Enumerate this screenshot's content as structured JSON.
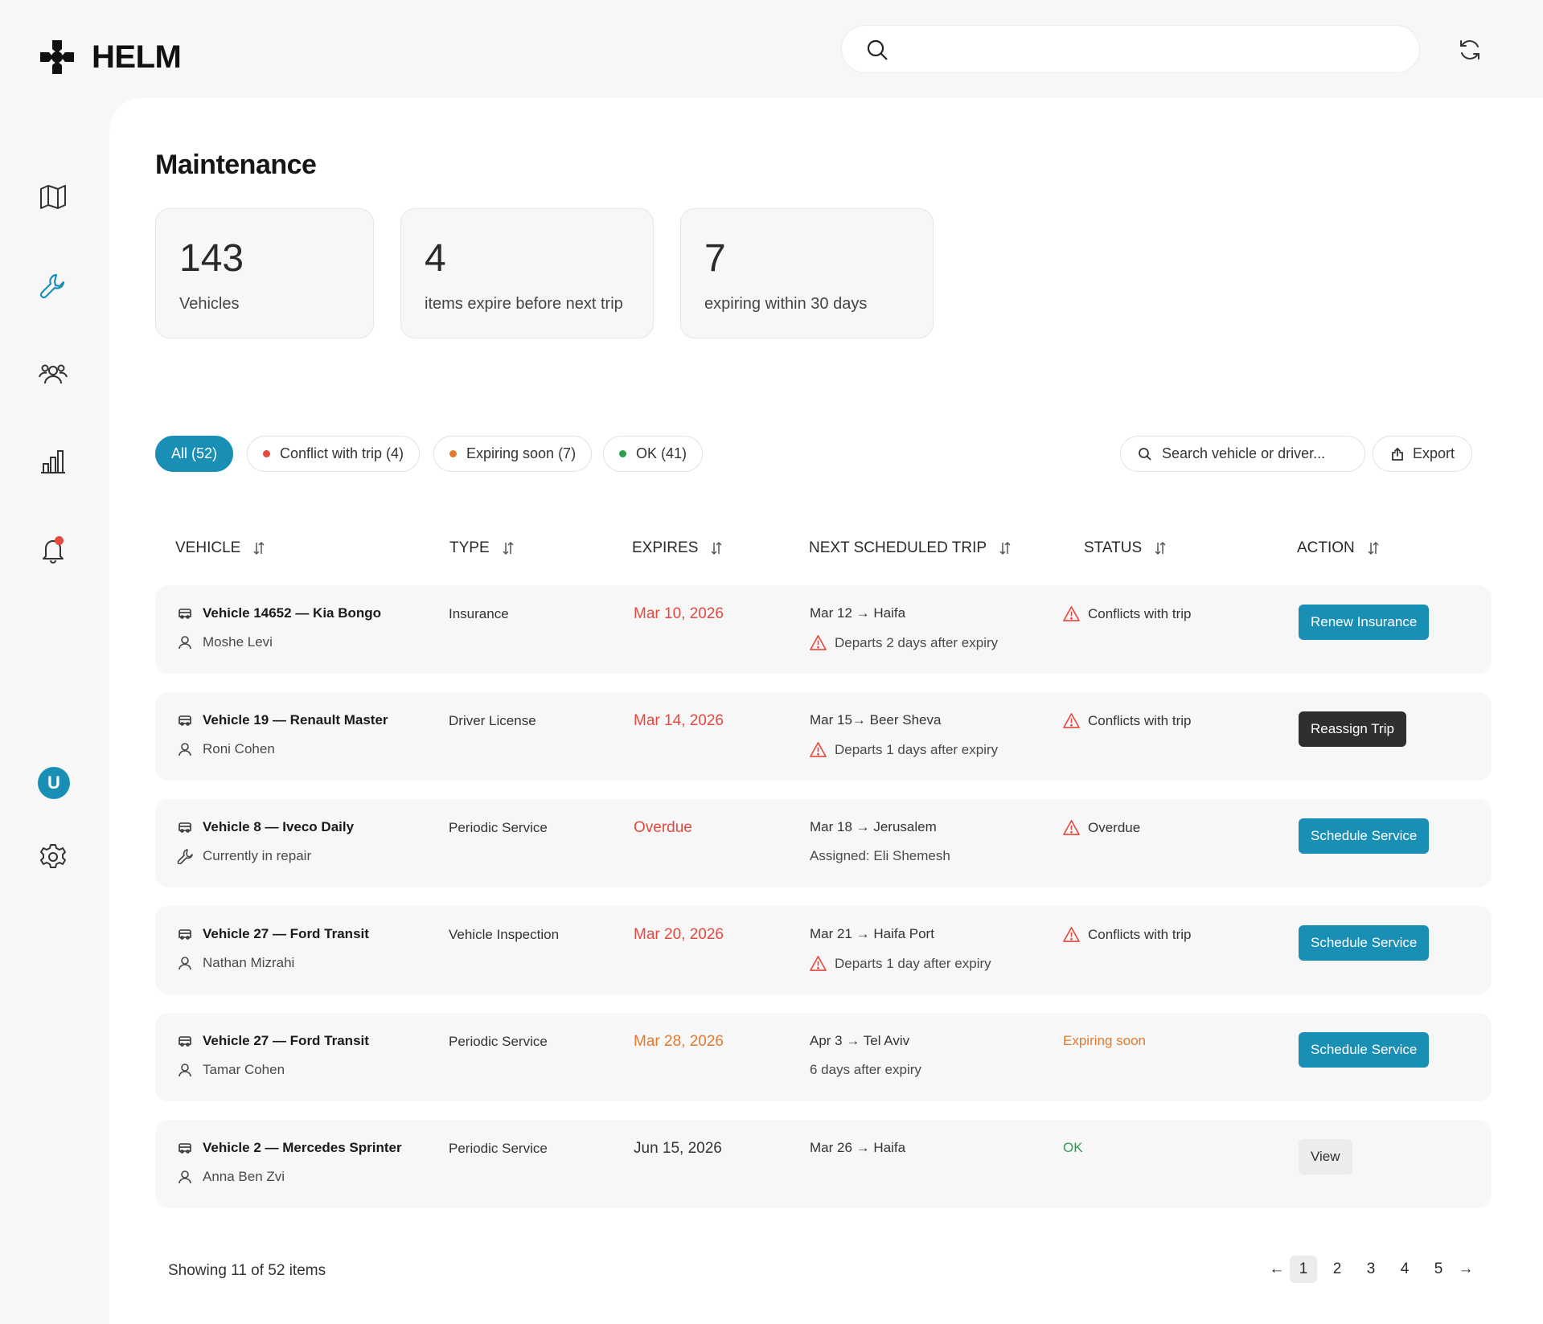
{
  "app": {
    "name": "HELM"
  },
  "header": {
    "search_placeholder": ""
  },
  "page": {
    "title": "Maintenance"
  },
  "stats": [
    {
      "value": "143",
      "label": "Vehicles"
    },
    {
      "value": "4",
      "label": "items expire before next trip"
    },
    {
      "value": "7",
      "label": "expiring within 30 days"
    }
  ],
  "filters": [
    {
      "label": "All (52)",
      "active": true
    },
    {
      "label": "Conflict with trip (4)",
      "dot": "#e5483f"
    },
    {
      "label": "Expiring soon (7)",
      "dot": "#e37a2e"
    },
    {
      "label": "OK (41)",
      "dot": "#2e9e4c"
    }
  ],
  "table_search": {
    "placeholder": "Search vehicle or driver..."
  },
  "export_label": "Export",
  "columns": [
    "VEHICLE",
    "TYPE",
    "EXPIRES",
    "NEXT SCHEDULED TRIP",
    "STATUS",
    "ACTION"
  ],
  "rows": [
    {
      "vehicle": "Vehicle 14652 — Kia Bongo",
      "sub": "Moshe Levi",
      "sub_icon": "user-icon",
      "type": "Insurance",
      "expires": "Mar 10, 2026",
      "expires_color": "red",
      "trip": "Mar 12 → Haifa",
      "trip_note": "Departs 2 days after expiry",
      "trip_note_warn": true,
      "status": "Conflicts with trip",
      "status_kind": "warn",
      "action": "Renew Insurance",
      "action_style": "blue"
    },
    {
      "vehicle": "Vehicle 19 — Renault Master",
      "sub": "Roni Cohen",
      "sub_icon": "user-icon",
      "type": "Driver License",
      "expires": "Mar 14, 2026",
      "expires_color": "red",
      "trip": "Mar 15→ Beer Sheva",
      "trip_note": "Departs 1 days after expiry",
      "trip_note_warn": true,
      "status": "Conflicts with trip",
      "status_kind": "warn",
      "action": "Reassign Trip",
      "action_style": "dark"
    },
    {
      "vehicle": "Vehicle 8 — Iveco Daily",
      "sub": "Currently in repair",
      "sub_icon": "wrench-icon",
      "type": "Periodic Service",
      "expires": "Overdue",
      "expires_color": "red",
      "trip": "Mar 18 → Jerusalem",
      "trip_note": "Assigned: Eli Shemesh",
      "trip_note_warn": false,
      "status": "Overdue",
      "status_kind": "warn",
      "action": "Schedule Service",
      "action_style": "blue"
    },
    {
      "vehicle": "Vehicle 27 — Ford Transit",
      "sub": "Nathan Mizrahi",
      "sub_icon": "user-icon",
      "type": "Vehicle Inspection",
      "expires": "Mar 20, 2026",
      "expires_color": "red",
      "trip": "Mar 21 → Haifa Port",
      "trip_note": "Departs 1 day after expiry",
      "trip_note_warn": true,
      "status": "Conflicts with trip",
      "status_kind": "warn",
      "action": "Schedule Service",
      "action_style": "blue"
    },
    {
      "vehicle": "Vehicle 27 — Ford Transit",
      "sub": "Tamar Cohen",
      "sub_icon": "user-icon",
      "type": "Periodic Service",
      "expires": "Mar 28, 2026",
      "expires_color": "orange",
      "trip": "Apr 3 → Tel Aviv",
      "trip_note": "6 days after expiry",
      "trip_note_warn": false,
      "status": "Expiring soon",
      "status_kind": "orange",
      "action": "Schedule Service",
      "action_style": "blue"
    },
    {
      "vehicle": "Vehicle 2 — Mercedes Sprinter",
      "sub": "Anna Ben Zvi",
      "sub_icon": "user-icon",
      "type": "Periodic Service",
      "expires": "Jun 15, 2026",
      "expires_color": "normal",
      "trip": "Mar 26 → Haifa",
      "trip_note": "",
      "trip_note_warn": false,
      "status": "OK",
      "status_kind": "green",
      "action": "View",
      "action_style": "grey"
    }
  ],
  "footer": {
    "showing": "Showing 11 of 52 items",
    "prev": "←",
    "next": "→",
    "pages": [
      "1",
      "2",
      "3",
      "4",
      "5"
    ],
    "current_page": "1"
  },
  "colors": {
    "accent": "#1a8fb5",
    "danger": "#e5483f",
    "warning": "#e37a2e",
    "success": "#2e9e4c"
  },
  "avatar": {
    "initial": "U"
  }
}
